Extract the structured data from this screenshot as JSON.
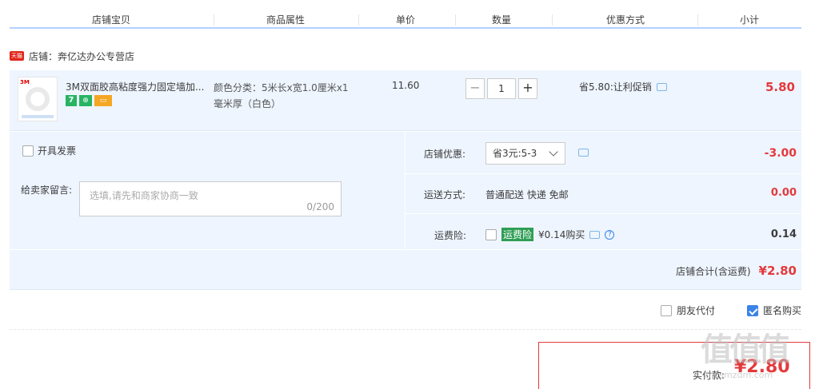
{
  "header": {
    "cols": [
      "店铺宝贝",
      "商品属性",
      "单价",
      "数量",
      "优惠方式",
      "小计"
    ]
  },
  "shop": {
    "badge": "天猫",
    "label": "店铺：",
    "name": "奔亿达办公专营店"
  },
  "item": {
    "brand": "3M",
    "title": "3M双面胶高粘度强力固定墙加...",
    "badges": [
      "7",
      "⊕",
      "▭"
    ],
    "attr_line1": "颜色分类：5米长x宽1.0厘米x1",
    "attr_line2": "毫米厚（白色）",
    "price": "11.60",
    "qty_minus": "−",
    "qty_value": "1",
    "qty_plus": "+",
    "promo": "省5.80:让利促销",
    "subtotal": "5.80"
  },
  "panel": {
    "invoice": "开具发票",
    "msg_label": "给卖家留言:",
    "msg_placeholder": "选填,请先和商家协商一致",
    "msg_count": "0/200",
    "coupon_label": "店铺优惠:",
    "coupon_value": "省3元:5-3",
    "coupon_amount": "-3.00",
    "ship_label": "运送方式:",
    "ship_value": "普通配送 快递 免邮",
    "ship_amount": "0.00",
    "ins_label": "运费险:",
    "ins_badge": "运费险",
    "ins_price": "¥0.14购买",
    "ins_amount": "0.14",
    "total_label": "店铺合计(含运费)",
    "total_value": "¥2.80"
  },
  "options": {
    "friend_pay": "朋友代付",
    "anonymous": "匿名购买"
  },
  "pay": {
    "label": "实付款:",
    "value": "¥2.80"
  },
  "watermark": {
    "big": "值值值",
    "small": "zhi.smzdm.com"
  }
}
